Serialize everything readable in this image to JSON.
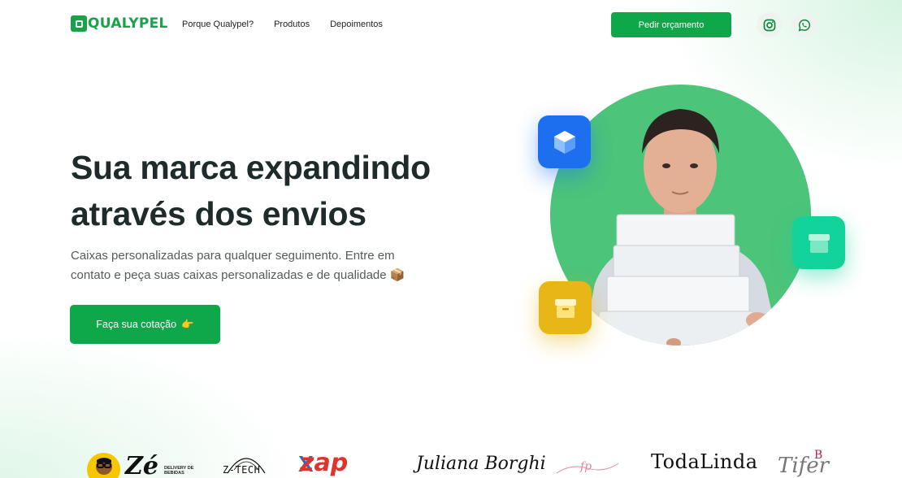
{
  "header": {
    "logo_text": "QUALYPEL",
    "nav": [
      "Porque Qualypel?",
      "Produtos",
      "Depoimentos"
    ],
    "cta": "Pedir orçamento",
    "social": [
      "instagram-icon",
      "whatsapp-icon"
    ]
  },
  "hero": {
    "title_line1": "Sua marca expandindo",
    "title_line2": "através dos envios",
    "desc_line1": "Caixas personalizadas para qualquer seguimento. Entre em",
    "desc_line2": "contato e peça suas caixas personalizadas e de qualidade 📦",
    "button": "Faça sua cotação",
    "button_emoji": "👉"
  },
  "brands": {
    "ze_word": "Zé",
    "ze_sub": "DELIVERY DE BEBIDAS",
    "ztech": "Z-TECH",
    "zap_x": "X",
    "zap": "zap",
    "juliana": "Juliana Borghi",
    "fp": "fp",
    "todalinda": "TodaLinda",
    "tifer": "Tifer",
    "tifer_mark": "B"
  },
  "colors": {
    "brand_green": "#16a34a",
    "button_green": "#0ea84a",
    "circle_green": "#4cc47a",
    "blue_tile": "#1e6ff0",
    "teal_tile": "#12d39a",
    "yellow_tile": "#e9b617"
  }
}
